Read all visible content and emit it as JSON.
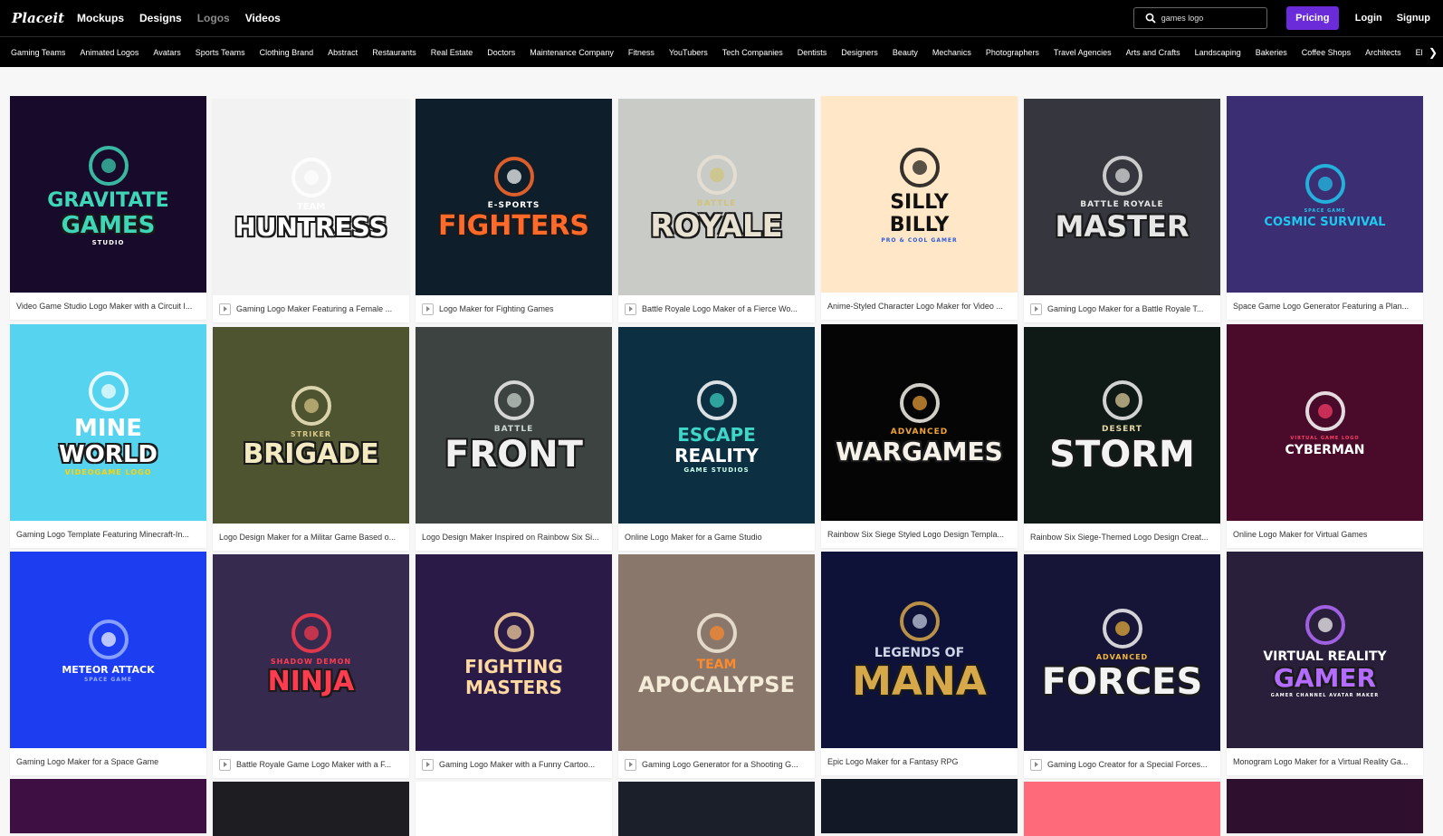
{
  "header": {
    "brand": "Placeit",
    "nav": [
      "Mockups",
      "Designs",
      "Logos",
      "Videos"
    ],
    "search_value": "games logo",
    "pricing": "Pricing",
    "login": "Login",
    "signup": "Signup"
  },
  "categories": [
    "Gaming Teams",
    "Animated Logos",
    "Avatars",
    "Sports Teams",
    "Clothing Brand",
    "Abstract",
    "Restaurants",
    "Real Estate",
    "Doctors",
    "Maintenance Company",
    "Fitness",
    "YouTubers",
    "Tech Companies",
    "Dentists",
    "Designers",
    "Beauty",
    "Mechanics",
    "Photographers",
    "Travel Agencies",
    "Arts and Crafts",
    "Landscaping",
    "Bakeries",
    "Coffee Shops",
    "Architects",
    "Electricians"
  ],
  "colors": {
    "pricing_bg": "#6b2bd9",
    "topbar_bg": "#000000",
    "page_bg": "#f7f7f7"
  },
  "cards": [
    {
      "caption": "Video Game Studio Logo Maker with a Circuit I...",
      "animated": false,
      "bg": "#170a2b",
      "logo": [
        "GRAVITATE",
        "GAMES",
        "STUDIO"
      ]
    },
    {
      "caption": "Gaming Logo Maker Featuring a Female ...",
      "animated": true,
      "bg": "#f2f2f2",
      "logo": [
        "TEAM",
        "HUNTRESS"
      ]
    },
    {
      "caption": "Logo Maker for Fighting Games",
      "animated": true,
      "bg": "#0f1e2b",
      "logo": [
        "E-SPORTS",
        "FIGHTERS"
      ]
    },
    {
      "caption": "Battle Royale Logo Maker of a Fierce Wo...",
      "animated": true,
      "bg": "#c9cbc7",
      "logo": [
        "BATTLE",
        "ROYALE"
      ]
    },
    {
      "caption": "Anime-Styled Character Logo Maker for Video ...",
      "animated": false,
      "bg": "#ffe7c7",
      "logo": [
        "SILLY",
        "BILLY",
        "PRO & COOL GAMER"
      ]
    },
    {
      "caption": "Gaming Logo Maker for a Battle Royale T...",
      "animated": true,
      "bg": "#35363e",
      "logo": [
        "BATTLE ROYALE",
        "MASTER"
      ]
    },
    {
      "caption": "Space Game Logo Generator Featuring a Plan...",
      "animated": false,
      "bg": "#3c2e72",
      "logo": [
        "SPACE GAME",
        "COSMIC SURVIVAL"
      ]
    },
    {
      "caption": "Gaming Logo Template Featuring Minecraft-In...",
      "animated": false,
      "bg": "#56d3ef",
      "logo": [
        "MINE",
        "WORLD",
        "VIDEOGAME LOGO"
      ]
    },
    {
      "caption": "Logo Design Maker for a Militar Game Based o...",
      "animated": false,
      "bg": "#4e5330",
      "logo": [
        "STRIKER",
        "BRIGADE"
      ]
    },
    {
      "caption": "Logo Design Maker Inspired on Rainbow Six Si...",
      "animated": false,
      "bg": "#3c4340",
      "logo": [
        "BATTLE",
        "FRONT"
      ]
    },
    {
      "caption": "Online Logo Maker for a Game Studio",
      "animated": false,
      "bg": "#0d2f42",
      "logo": [
        "ESCAPE",
        "REALITY",
        "GAME STUDIOS"
      ]
    },
    {
      "caption": "Rainbow Six Siege Styled Logo Design Templa...",
      "animated": false,
      "bg": "#050505",
      "logo": [
        "ADVANCED",
        "WARGAMES"
      ]
    },
    {
      "caption": "Rainbow Six Siege-Themed Logo Design Creat...",
      "animated": false,
      "bg": "#0f1a17",
      "logo": [
        "DESERT",
        "STORM"
      ]
    },
    {
      "caption": "Online Logo Maker for Virtual Games",
      "animated": false,
      "bg": "#4a0b2a",
      "logo": [
        "VIRTUAL GAME LOGO",
        "CYBERMAN"
      ]
    },
    {
      "caption": "Gaming Logo Maker for a Space Game",
      "animated": false,
      "bg": "#1d3ef0",
      "logo": [
        "METEOR ATTACK",
        "SPACE GAME"
      ]
    },
    {
      "caption": "Battle Royale Game Logo Maker with a F...",
      "animated": true,
      "bg": "#362a4e",
      "logo": [
        "SHADOW DEMON",
        "NINJA"
      ]
    },
    {
      "caption": "Gaming Logo Maker with a Funny Cartoo...",
      "animated": true,
      "bg": "#2a1a47",
      "logo": [
        "FIGHTING",
        "MASTERS"
      ]
    },
    {
      "caption": "Gaming Logo Generator for a Shooting G...",
      "animated": true,
      "bg": "#8a776c",
      "logo": [
        "TEAM",
        "APOCALYPSE"
      ]
    },
    {
      "caption": "Epic Logo Maker for a Fantasy RPG",
      "animated": false,
      "bg": "#0f1238",
      "logo": [
        "LEGENDS OF",
        "MANA"
      ]
    },
    {
      "caption": "Gaming Logo Creator for a Special Forces...",
      "animated": true,
      "bg": "#161538",
      "logo": [
        "ADVANCED",
        "FORCES"
      ]
    },
    {
      "caption": "Monogram Logo Maker for a Virtual Reality Ga...",
      "animated": false,
      "bg": "#2a1f3a",
      "logo": [
        "VIRTUAL REALITY",
        "GAMER",
        "GAMER CHANNEL AVATAR MAKER"
      ]
    }
  ],
  "partial_row_colors": [
    "#3d0f43",
    "#1e1e22",
    "#ffffff",
    "#1a1f2a",
    "#121826",
    "#ff6a7a",
    "#2e0f2e"
  ]
}
